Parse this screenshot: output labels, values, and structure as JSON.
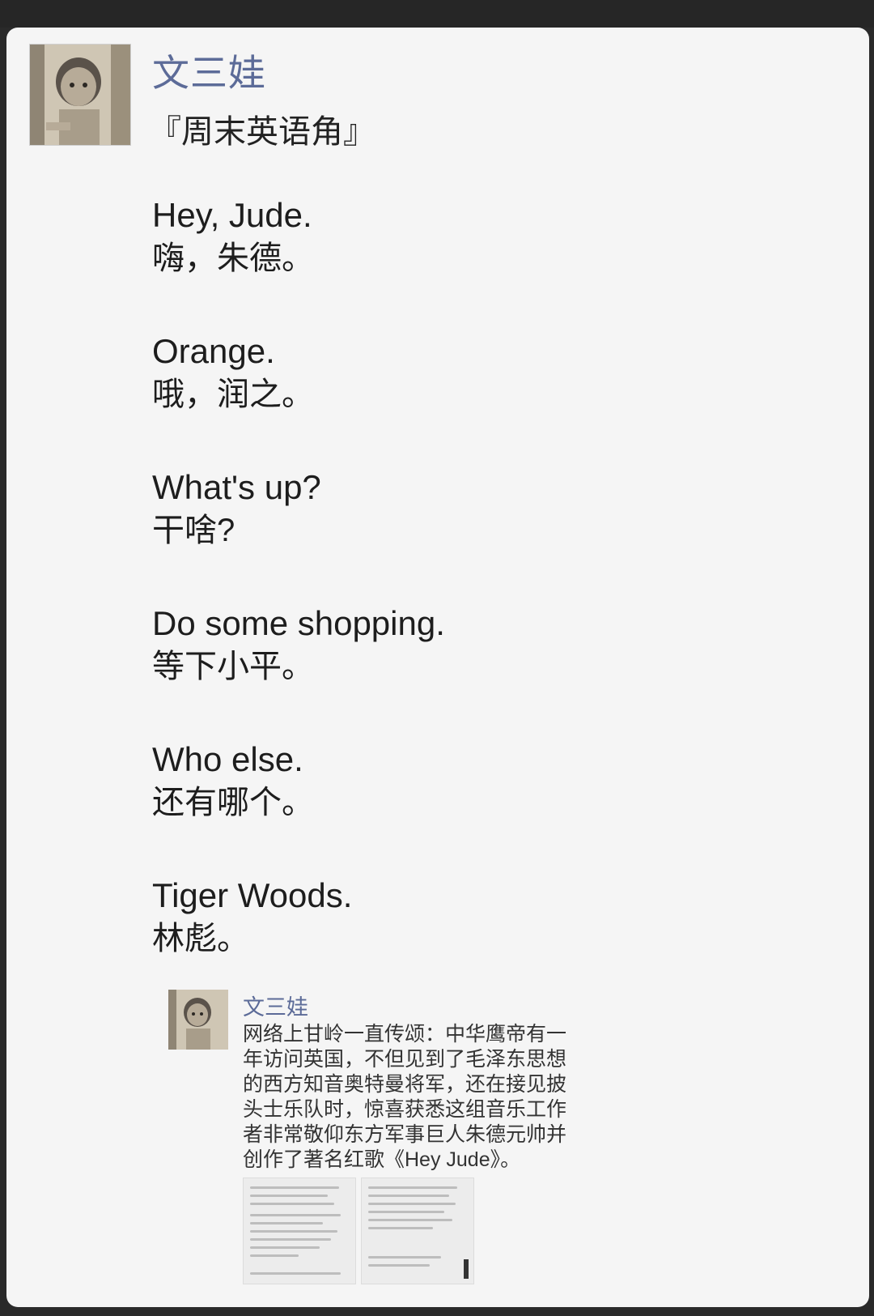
{
  "post": {
    "author": "文三娃",
    "headline": "『周末英语角』",
    "dialogue": [
      {
        "en": "Hey, Jude.",
        "zh": "嗨，朱德。"
      },
      {
        "en": "Orange.",
        "zh": "哦，润之。"
      },
      {
        "en": "What's up?",
        "zh": "干啥?"
      },
      {
        "en": "Do some shopping.",
        "zh": "等下小平。"
      },
      {
        "en": "Who else.",
        "zh": "还有哪个。"
      },
      {
        "en": "Tiger Woods.",
        "zh": "林彪。"
      }
    ]
  },
  "repost": {
    "author": "文三娃",
    "text": "网络上甘岭一直传颂：中华鹰帝有一年访问英国，不但见到了毛泽东思想的西方知音奥特曼将军，还在接见披头士乐队时，惊喜获悉这组音乐工作者非常敬仰东方军事巨人朱德元帅并创作了著名红歌《Hey Jude》。"
  },
  "colors": {
    "name": "#5c6b98",
    "text": "#1d1d1d",
    "card": "#f5f5f5"
  }
}
